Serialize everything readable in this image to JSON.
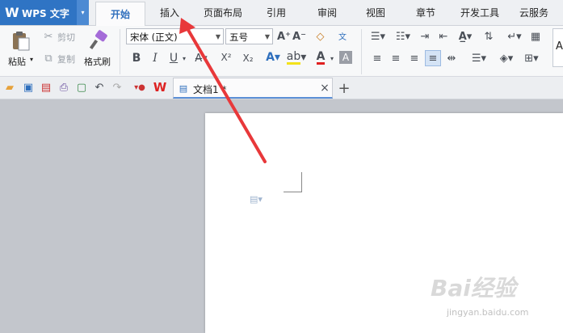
{
  "app": {
    "logo_glyph": "W",
    "title": "WPS 文字",
    "menu_arrow": "▾"
  },
  "tabs": [
    {
      "label": "开始",
      "active": true
    },
    {
      "label": "插入"
    },
    {
      "label": "页面布局"
    },
    {
      "label": "引用"
    },
    {
      "label": "审阅"
    },
    {
      "label": "视图"
    },
    {
      "label": "章节"
    },
    {
      "label": "开发工具"
    },
    {
      "label": "云服务"
    }
  ],
  "clipboard": {
    "paste": "粘贴",
    "cut": "剪切",
    "copy": "复制",
    "format_painter": "格式刷"
  },
  "font": {
    "name": "宋体 (正文)",
    "size": "五号"
  },
  "format": {
    "bold": "B",
    "italic": "I",
    "underline": "U",
    "superscript": "X²",
    "subscript": "X₂",
    "font_color": "A",
    "grow": "A⁺",
    "shrink": "A⁻"
  },
  "style_preview": "A",
  "document": {
    "tab_title": "文档1 *",
    "close_glyph": "×",
    "new_tab_glyph": "+"
  },
  "watermark": {
    "logo": "Bai经验",
    "url": "jingyan.baidu.com"
  },
  "colors": {
    "accent": "#2f74c4",
    "arrow": "#e8383a"
  }
}
